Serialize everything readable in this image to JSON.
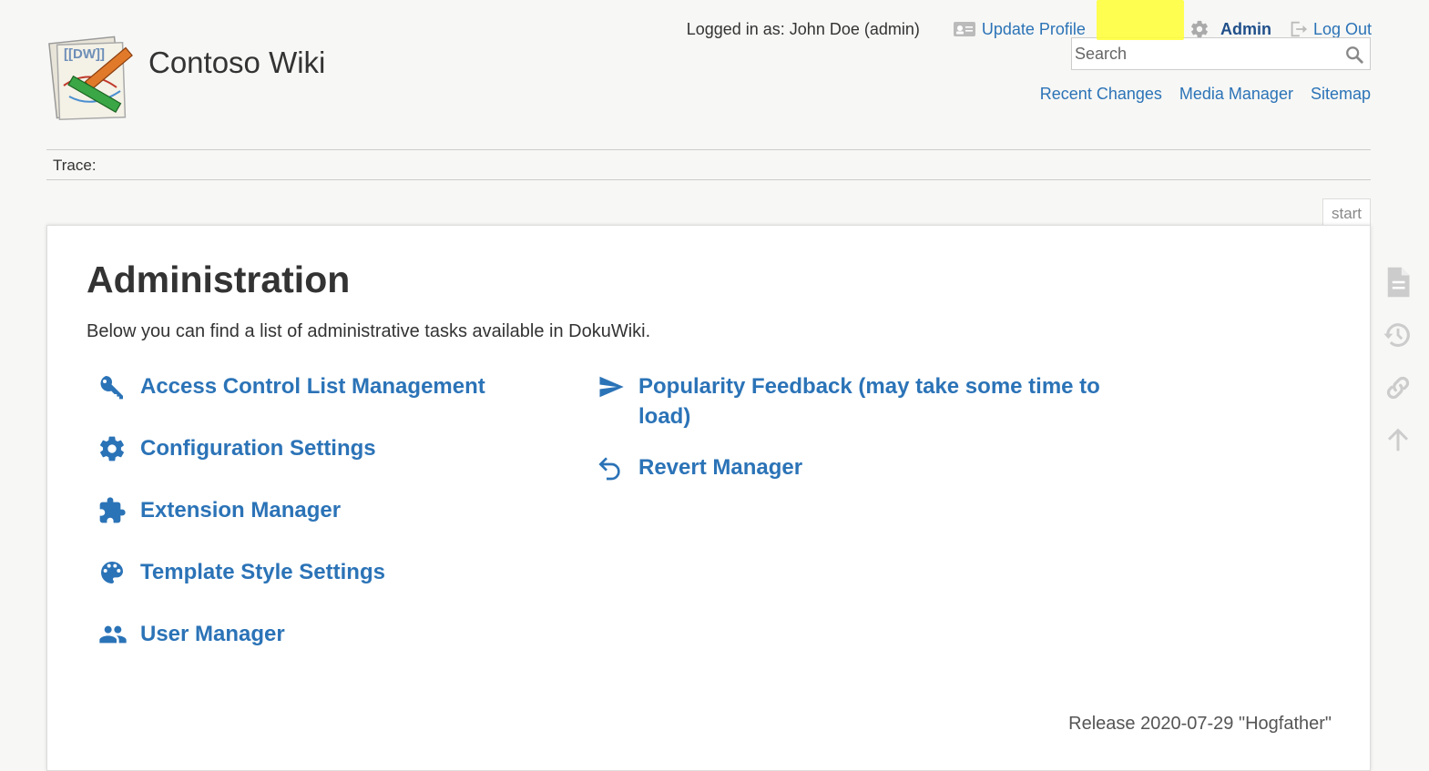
{
  "site": {
    "title": "Contoso Wiki"
  },
  "user_tools": {
    "logged_in_label": "Logged in as: John Doe (admin)",
    "update_profile": "Update Profile",
    "admin": "Admin",
    "log_out": "Log Out"
  },
  "search": {
    "placeholder": "Search"
  },
  "site_tools": {
    "recent_changes": "Recent Changes",
    "media_manager": "Media Manager",
    "sitemap": "Sitemap"
  },
  "breadcrumbs": {
    "trace_label": "Trace:"
  },
  "page": {
    "tab_label": "start",
    "title": "Administration",
    "intro": "Below you can find a list of administrative tasks available in DokuWiki.",
    "left_items": [
      {
        "label": "Access Control List Management",
        "icon": "key-icon"
      },
      {
        "label": "Configuration Settings",
        "icon": "gear-icon"
      },
      {
        "label": "Extension Manager",
        "icon": "puzzle-icon"
      },
      {
        "label": "Template Style Settings",
        "icon": "palette-icon"
      },
      {
        "label": "User Manager",
        "icon": "users-icon"
      }
    ],
    "right_items": [
      {
        "label": "Popularity Feedback (may take some time to load)",
        "icon": "send-icon"
      },
      {
        "label": "Revert Manager",
        "icon": "undo-icon"
      }
    ],
    "release": "Release 2020-07-29 \"Hogfather\""
  },
  "page_tools": [
    "show-page-icon",
    "old-revisions-icon",
    "backlinks-icon",
    "back-to-top-icon"
  ],
  "colors": {
    "link": "#2b73b7",
    "highlight": "#ffff33",
    "text": "#333333",
    "background": "#f7f7f5"
  }
}
